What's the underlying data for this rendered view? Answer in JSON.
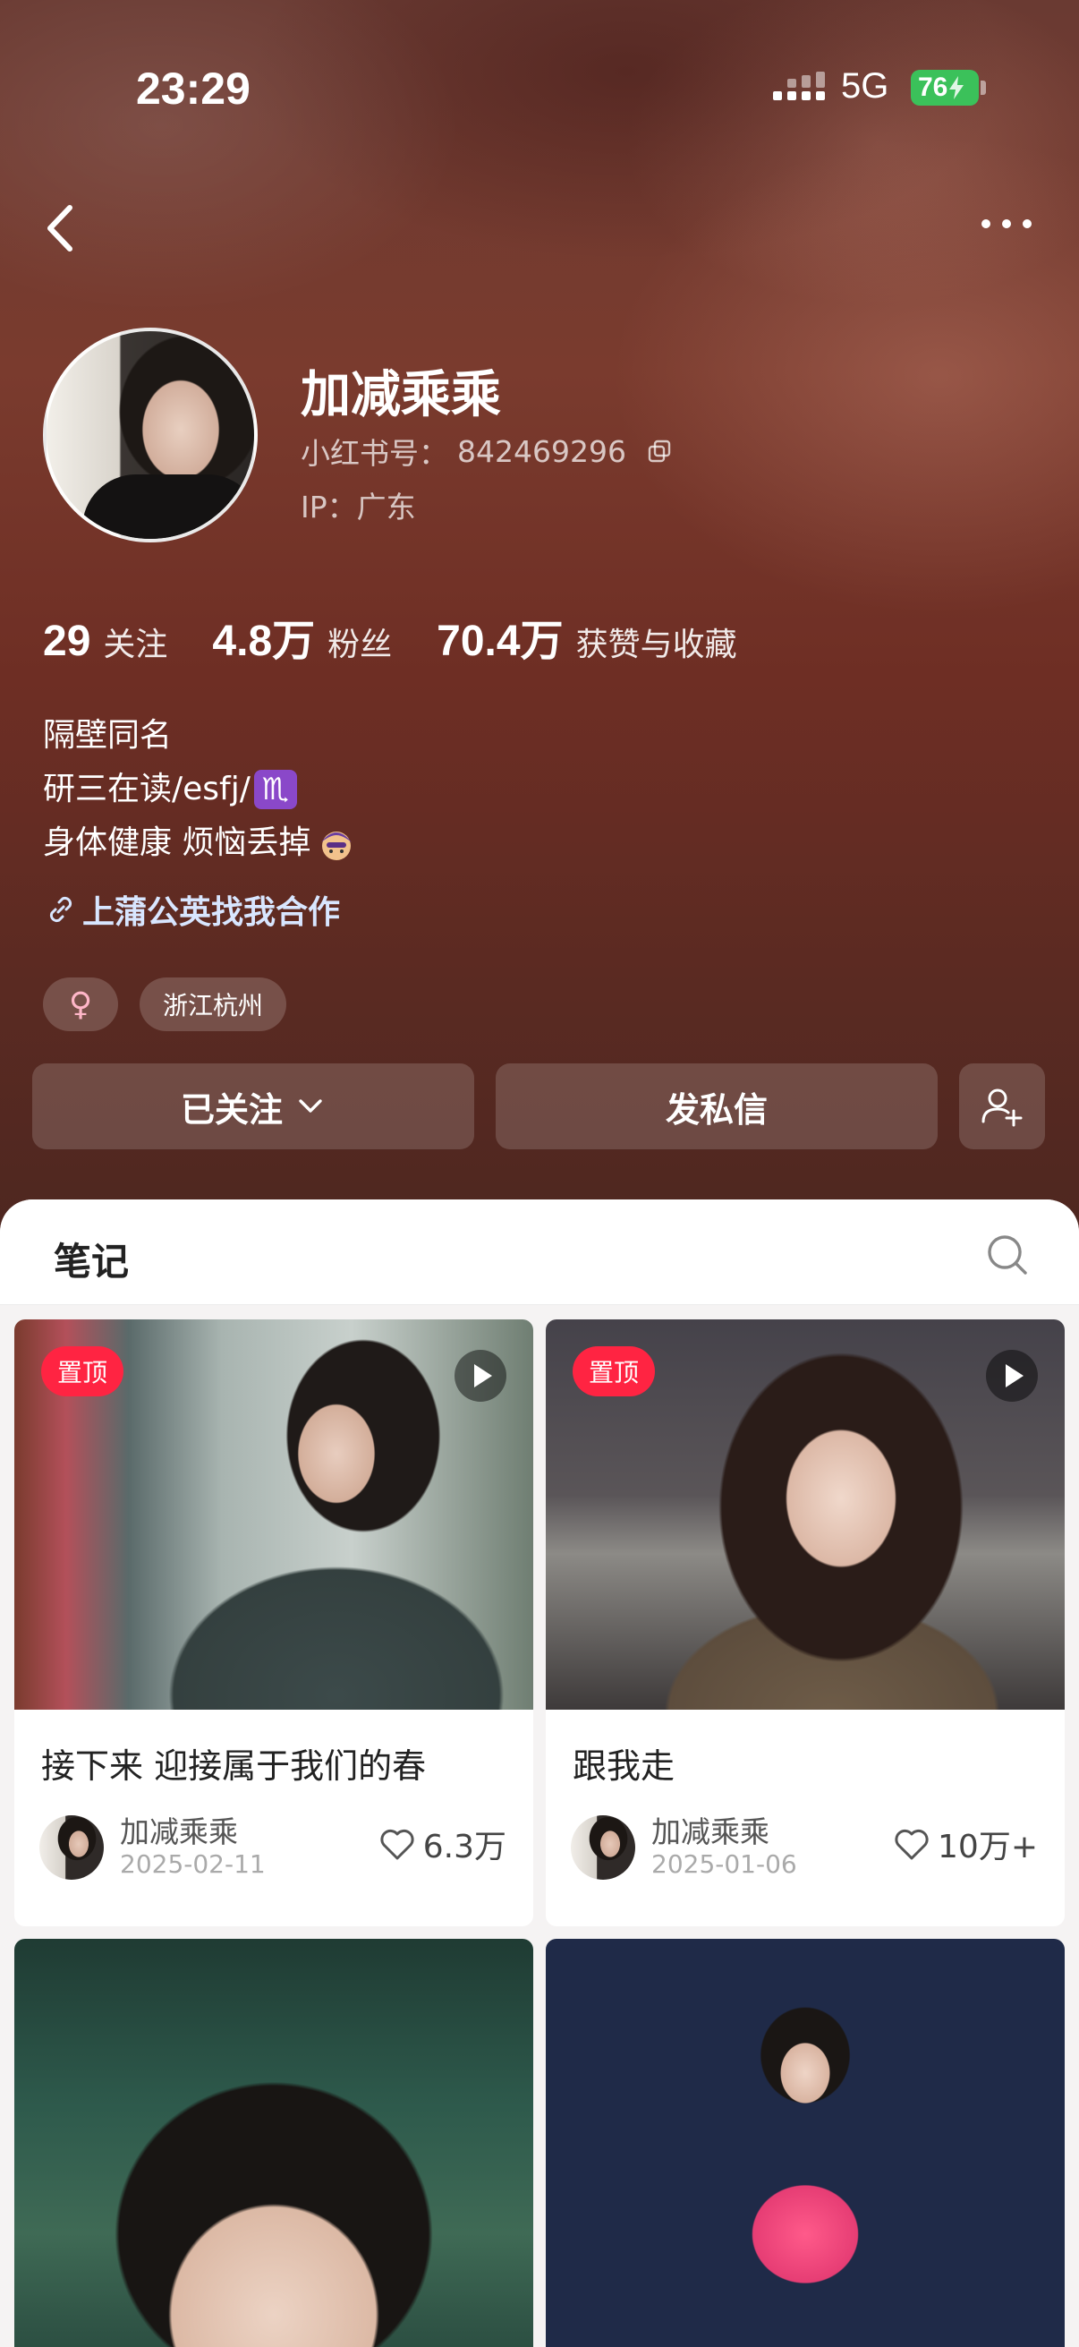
{
  "status_bar": {
    "time": "23:29",
    "network": "5G",
    "battery": "76"
  },
  "profile": {
    "nickname": "加减乘乘",
    "account_label": "小红书号：",
    "account_id": "842469296",
    "ip_label": "IP：",
    "ip_location": "广东",
    "stats": [
      {
        "value": "29",
        "label": "关注"
      },
      {
        "value": "4.8万",
        "label": "粉丝"
      },
      {
        "value": "70.4万",
        "label": "获赞与收藏"
      }
    ],
    "bio": [
      "隔壁同名",
      "研三在读/esfj/",
      "身体健康 烦恼丢掉"
    ],
    "zodiac_glyph": "♏",
    "collab_link": "上蒲公英找我合作",
    "tags": {
      "gender": "♀",
      "location": "浙江杭州"
    }
  },
  "actions": {
    "following": "已关注",
    "message": "发私信"
  },
  "notes": {
    "tab_title": "笔记",
    "cards": [
      {
        "pinned": "置顶",
        "title": "接下来 迎接属于我们的春",
        "author": "加减乘乘",
        "date": "2025-02-11",
        "likes": "6.3万"
      },
      {
        "pinned": "置顶",
        "title": "跟我走",
        "author": "加减乘乘",
        "date": "2025-01-06",
        "likes": "10万+"
      }
    ]
  },
  "colors": {
    "accent": "#ff2442",
    "hero": "#7a3b2e",
    "battery": "#3bc15a"
  }
}
